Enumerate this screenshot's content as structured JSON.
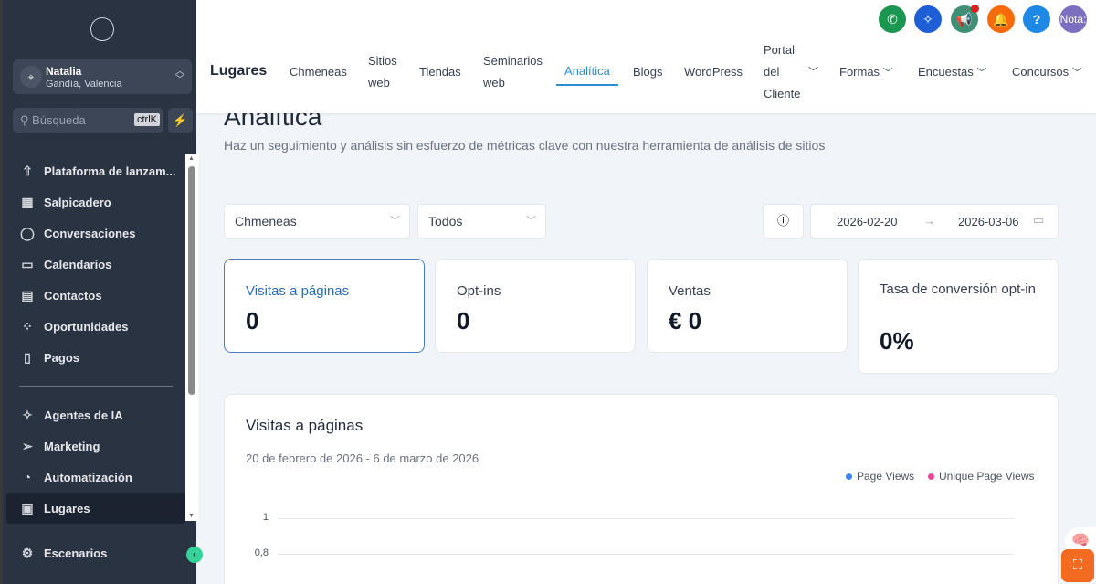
{
  "sidebar": {
    "account": {
      "name": "Natalia",
      "location": "Gandía, Valencia"
    },
    "search": {
      "placeholder": "Búsqueda",
      "shortcut": "ctrlK"
    },
    "items": [
      {
        "label": "Plataforma de lanzam...",
        "icon": "rocket-icon"
      },
      {
        "label": "Salpicadero",
        "icon": "grid-icon"
      },
      {
        "label": "Conversaciones",
        "icon": "chat-icon"
      },
      {
        "label": "Calendarios",
        "icon": "calendar-icon"
      },
      {
        "label": "Contactos",
        "icon": "contacts-icon"
      },
      {
        "label": "Oportunidades",
        "icon": "opportunities-icon"
      },
      {
        "label": "Pagos",
        "icon": "payments-icon"
      }
    ],
    "items2": [
      {
        "label": "Agentes de IA",
        "icon": "sparkle-icon"
      },
      {
        "label": "Marketing",
        "icon": "send-icon"
      },
      {
        "label": "Automatización",
        "icon": "automation-icon"
      },
      {
        "label": "Lugares",
        "icon": "sites-icon"
      }
    ],
    "bottom": {
      "label": "Escenarios",
      "icon": "gear-icon"
    }
  },
  "topbar": {
    "icons": [
      {
        "name": "phone-icon",
        "color": "#1a9650"
      },
      {
        "name": "ai-sparkle-icon",
        "color": "#1f5fd6"
      },
      {
        "name": "megaphone-icon",
        "color": "#3f8f76"
      },
      {
        "name": "bell-icon",
        "color": "#f76b0c"
      },
      {
        "name": "help-icon",
        "color": "#1e88e5"
      }
    ],
    "avatar": "Nota:",
    "brand": "Lugares",
    "tabs": [
      "Chmeneas",
      "Sitios web",
      "Tiendas",
      "Seminarios web",
      "Analítica",
      "Blogs",
      "WordPress",
      "Portal del Cliente",
      "Formas",
      "Encuestas",
      "Concursos"
    ]
  },
  "page": {
    "title": "Analítica",
    "subtitle": "Haz un seguimiento y análisis sin esfuerzo de métricas clave con nuestra herramienta de análisis de sitios",
    "filter1": "Chmeneas",
    "filter2": "Todos",
    "date_start": "2026-02-20",
    "date_end": "2026-03-06",
    "stats": [
      {
        "label": "Visitas a páginas",
        "value": "0"
      },
      {
        "label": "Opt-ins",
        "value": "0"
      },
      {
        "label": "Ventas",
        "value": "€ 0"
      },
      {
        "label": "Tasa de conversión opt-in",
        "value": "0%"
      }
    ],
    "chart": {
      "title": "Visitas a páginas",
      "date_range": "20 de febrero de 2026 - 6 de marzo de 2026",
      "legend": [
        {
          "label": "Page Views",
          "color": "#3b82f6"
        },
        {
          "label": "Unique Page Views",
          "color": "#ec4899"
        }
      ],
      "y_ticks": [
        "1",
        "0,8"
      ]
    }
  },
  "accent": "#2b8ccf"
}
